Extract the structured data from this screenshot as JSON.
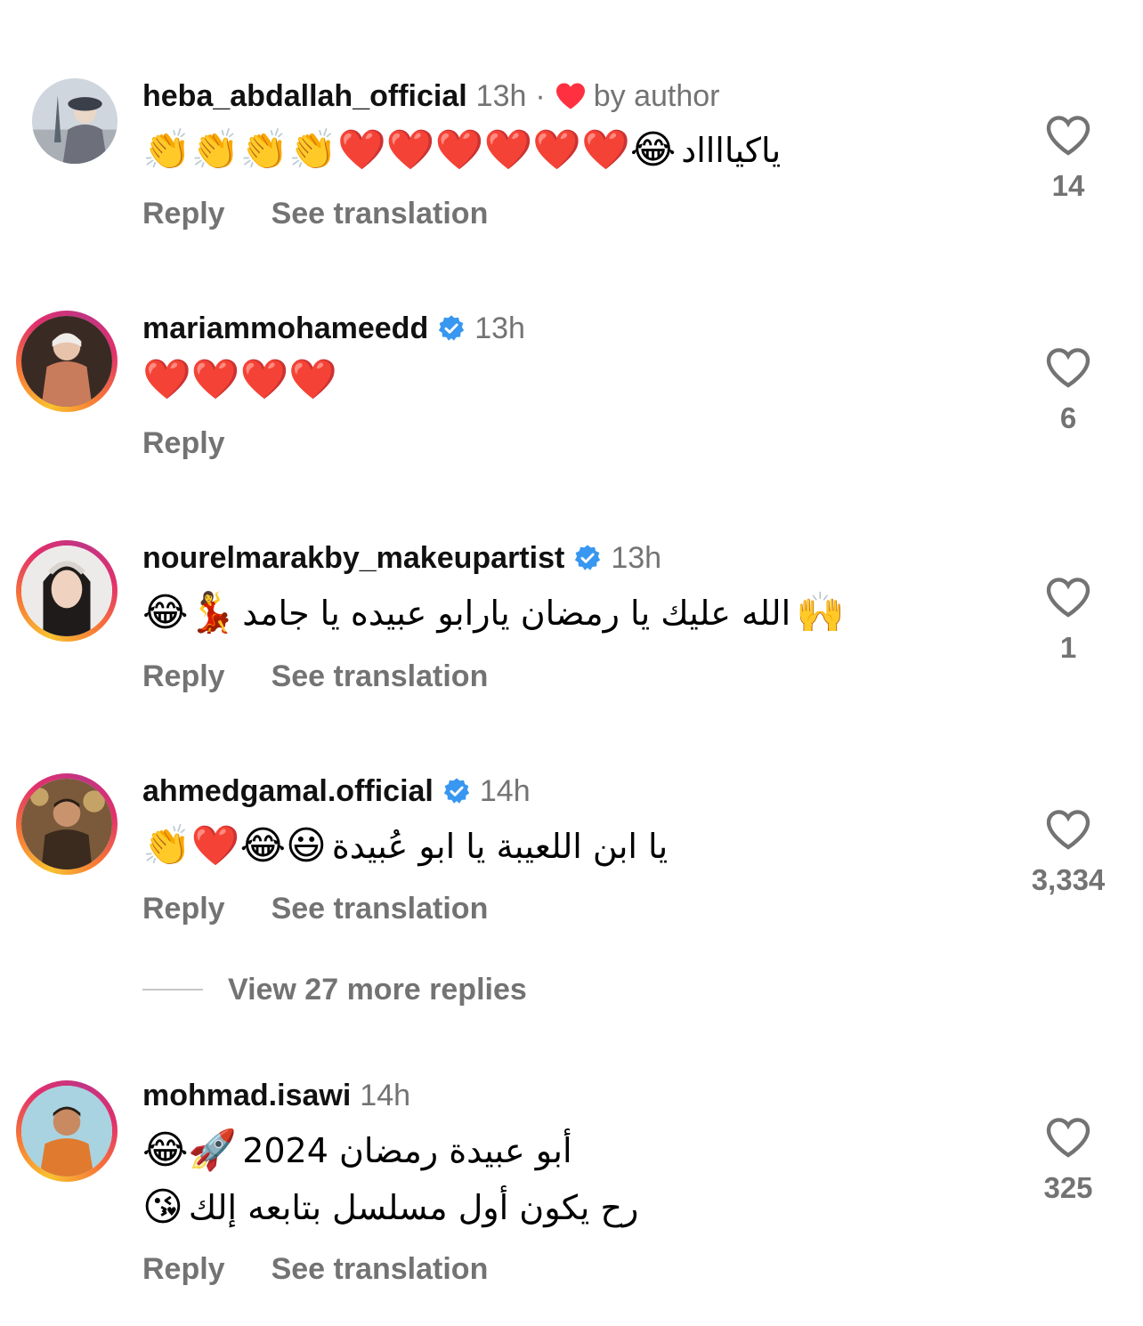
{
  "comments": [
    {
      "username": "heba_abdallah_official",
      "time": "13h",
      "author_badge": "by author",
      "dot": "·",
      "lines": [
        {
          "emojis_left": "👏👏👏👏❤️❤️❤️❤️❤️❤️😂",
          "arabic": "ياكيااااد"
        }
      ],
      "reply_label": "Reply",
      "translate_label": "See translation",
      "likes": "14"
    },
    {
      "username": "mariammohameedd",
      "time": "13h",
      "lines": [
        {
          "emojis_left": "❤️❤️❤️❤️"
        }
      ],
      "reply_label": "Reply",
      "likes": "6"
    },
    {
      "username": "nourelmarakby_makeupartist",
      "time": "13h",
      "lines": [
        {
          "emojis_left": "😂💃",
          "arabic": "الله عليك يا رمضان يارابو عبيده يا جامد",
          "emojis_right": "🙌"
        }
      ],
      "reply_label": "Reply",
      "translate_label": "See translation",
      "likes": "1"
    },
    {
      "username": "ahmedgamal.official",
      "time": "14h",
      "lines": [
        {
          "emojis_left": "👏❤️😂😃",
          "arabic": "يا ابن اللعيبة يا ابو عُبيدة"
        }
      ],
      "reply_label": "Reply",
      "translate_label": "See translation",
      "likes": "3,334"
    },
    {
      "username": "mohmad.isawi",
      "time": "14h",
      "lines": [
        {
          "emojis_left": "😂🚀",
          "arabic": "أبو عبيدة رمضان 2024"
        },
        {
          "emojis_left": "😘",
          "arabic": "رح يكون أول مسلسل بتابعه إلك"
        }
      ],
      "reply_label": "Reply",
      "translate_label": "See translation",
      "likes": "325"
    }
  ],
  "view_more_replies": "View 27 more replies",
  "icons": {
    "like": "heart-outline-icon",
    "verified": "verified-badge-icon",
    "author_like": "heart-filled-icon"
  },
  "colors": {
    "secondary_text": "#737373",
    "verified_blue": "#3897f0",
    "heart_red": "#ff3040"
  }
}
